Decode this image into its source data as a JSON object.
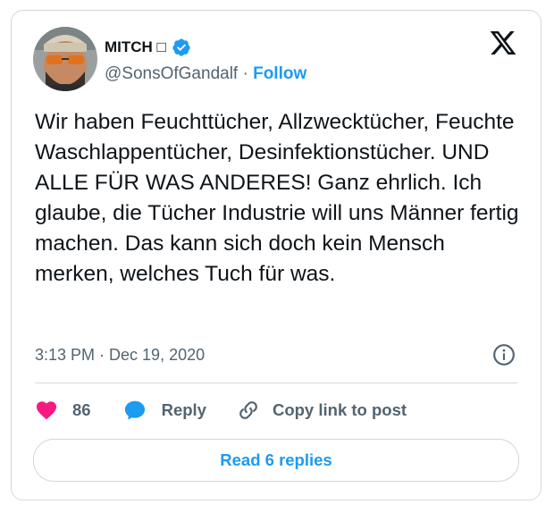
{
  "tweet": {
    "author": {
      "display_name": "MITCH □",
      "handle": "@SonsOfGandalf",
      "separator": " · ",
      "follow_label": "Follow",
      "verified": true,
      "avatar_icon": "profile-photo"
    },
    "brand_icon": "x-logo-icon",
    "text": "Wir haben Feuchttücher, Allzwecktücher, Feuchte Waschlappentücher, Desinfektionstücher. UND ALLE FÜR WAS ANDERES! Ganz ehrlich. Ich glaube, die Tücher Industrie will uns Männer fertig machen. Das kann sich doch kein Mensch merken, welches Tuch für was.",
    "timestamp": "3:13 PM · Dec 19, 2020",
    "actions": {
      "like_count": "86",
      "reply_label": "Reply",
      "copy_link_label": "Copy link to post"
    },
    "read_replies_label": "Read 6 replies"
  },
  "colors": {
    "accent": "#1d9bf0",
    "like": "#f91880",
    "reply_icon": "#1d9bf0",
    "text": "#0f1419",
    "muted": "#536471",
    "border": "#cfd9de"
  }
}
